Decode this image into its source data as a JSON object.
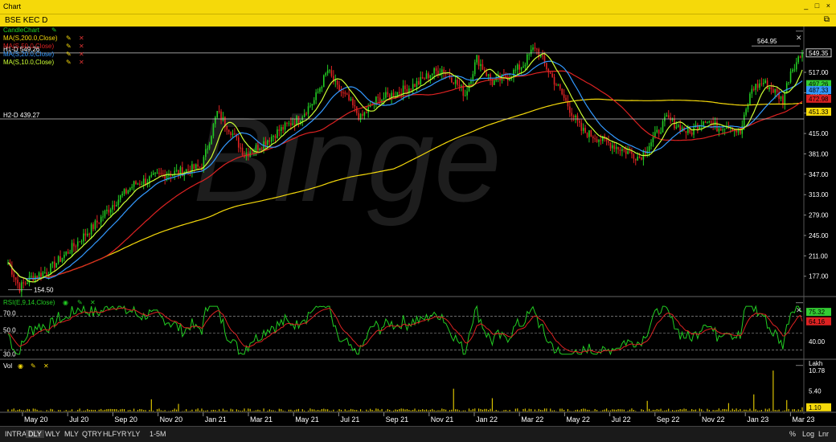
{
  "window": {
    "title": "Chart",
    "controls": "_ □ ×"
  },
  "toolbar": {
    "symbol": "BSE KEC D",
    "popout_icon": "window-restore-icon"
  },
  "legend_main": [
    {
      "label": "CandleChart",
      "color": "#22cc22"
    },
    {
      "label": "MA(S,200.0,Close)",
      "color": "#f5d90a"
    },
    {
      "label": "MA(S,50.0,Close)",
      "color": "#dd2222"
    },
    {
      "label": "MA(S,20.0,Close)",
      "color": "#3399ff"
    },
    {
      "label": "MA(S,10.0,Close)",
      "color": "#ccff33"
    }
  ],
  "hlines": [
    {
      "label": "H1-D 549.26",
      "value": 549.26
    },
    {
      "label": "H2-D 439.27",
      "value": 439.27
    }
  ],
  "annotations": {
    "high": "564.95",
    "low": "154.50"
  },
  "badges_main": [
    {
      "text": "549.35",
      "value": 549.35,
      "bg": "#000000",
      "fg": "#ffffff",
      "border": "#ffffff"
    },
    {
      "text": "497.26",
      "value": 497.26,
      "bg": "#33cc33",
      "fg": "#000000"
    },
    {
      "text": "487.33",
      "value": 487.33,
      "bg": "#3399ff",
      "fg": "#000000"
    },
    {
      "text": "472.98",
      "value": 472.98,
      "bg": "#dd2222",
      "fg": "#000000"
    },
    {
      "text": "451.33",
      "value": 451.33,
      "bg": "#f5d90a",
      "fg": "#000000"
    }
  ],
  "rsi": {
    "label": "RSI(E,9,14,Close)",
    "levels": [
      "70.0",
      "50.0",
      "30.0"
    ],
    "tick": "40.00",
    "badges": [
      {
        "text": "75.32",
        "value": 75.32,
        "bg": "#33cc33"
      },
      {
        "text": "64.16",
        "value": 64.16,
        "bg": "#dd2222"
      }
    ]
  },
  "volume": {
    "label": "Vol",
    "unit": "Lakh",
    "ticks": [
      "10.78",
      "5.40"
    ],
    "badge": {
      "text": "1.10",
      "value": 1.1,
      "bg": "#f5d90a"
    }
  },
  "bottom": {
    "items": [
      "INTRA",
      "DLY",
      "WLY",
      "MLY",
      "QTRY",
      "HLFYR",
      "YLY",
      "1-5M"
    ],
    "active": "DLY",
    "right_items": [
      "%",
      "Log",
      "Lnr"
    ]
  },
  "chart_data": {
    "type": "line",
    "title": "BSE KEC D",
    "y_ticks": [
      517.0,
      483.0,
      449.0,
      415.0,
      381.0,
      347.0,
      313.0,
      279.0,
      245.0,
      211.0,
      177.0
    ],
    "ylim": [
      154.5,
      564.95
    ],
    "x_tick_labels": [
      "May 20",
      "Jul 20",
      "Sep 20",
      "Nov 20",
      "Jan 21",
      "Mar 21",
      "May 21",
      "Jul 21",
      "Sep 21",
      "Nov 21",
      "Jan 22",
      "Mar 22",
      "May 22",
      "Jul 22",
      "Sep 22",
      "Nov 22",
      "Jan 23",
      "Mar 23"
    ],
    "close_anchors": {
      "x": [
        0,
        6,
        12,
        20,
        30,
        44,
        55,
        65,
        78,
        90,
        100,
        108,
        115,
        122,
        130,
        140,
        150,
        158,
        165,
        170,
        176,
        182,
        190,
        198,
        206,
        212,
        218,
        224,
        230,
        236,
        242,
        250,
        258,
        266,
        272,
        278,
        286,
        296,
        306,
        316,
        326,
        334,
        340,
        347,
        352,
        356,
        360,
        366,
        372,
        378,
        384,
        390,
        396,
        400,
        404,
        410
      ],
      "y": [
        200,
        158,
        175,
        185,
        215,
        260,
        300,
        330,
        345,
        352,
        360,
        450,
        420,
        380,
        395,
        420,
        440,
        470,
        520,
        490,
        470,
        440,
        470,
        480,
        490,
        500,
        515,
        522,
        505,
        480,
        540,
        500,
        510,
        530,
        560,
        525,
        480,
        420,
        405,
        390,
        375,
        410,
        440,
        425,
        415,
        430,
        440,
        425,
        430,
        415,
        490,
        500,
        485,
        470,
        520,
        549.35
      ]
    },
    "series": [
      {
        "name": "CandleChart",
        "color": "#22cc22"
      },
      {
        "name": "MA(S,200.0,Close)",
        "color": "#f5d90a",
        "period": 200
      },
      {
        "name": "MA(S,50.0,Close)",
        "color": "#dd2222",
        "period": 50
      },
      {
        "name": "MA(S,20.0,Close)",
        "color": "#3399ff",
        "period": 20
      },
      {
        "name": "MA(S,10.0,Close)",
        "color": "#ccff33",
        "period": 10
      }
    ],
    "volume_spikes": [
      {
        "x": 74,
        "v": 3.2
      },
      {
        "x": 88,
        "v": 2.0
      },
      {
        "x": 230,
        "v": 6.0
      },
      {
        "x": 250,
        "v": 3.5
      },
      {
        "x": 330,
        "v": 2.8
      },
      {
        "x": 372,
        "v": 2.2
      },
      {
        "x": 385,
        "v": 4.5
      },
      {
        "x": 395,
        "v": 10.78
      },
      {
        "x": 402,
        "v": 3.0
      }
    ]
  }
}
